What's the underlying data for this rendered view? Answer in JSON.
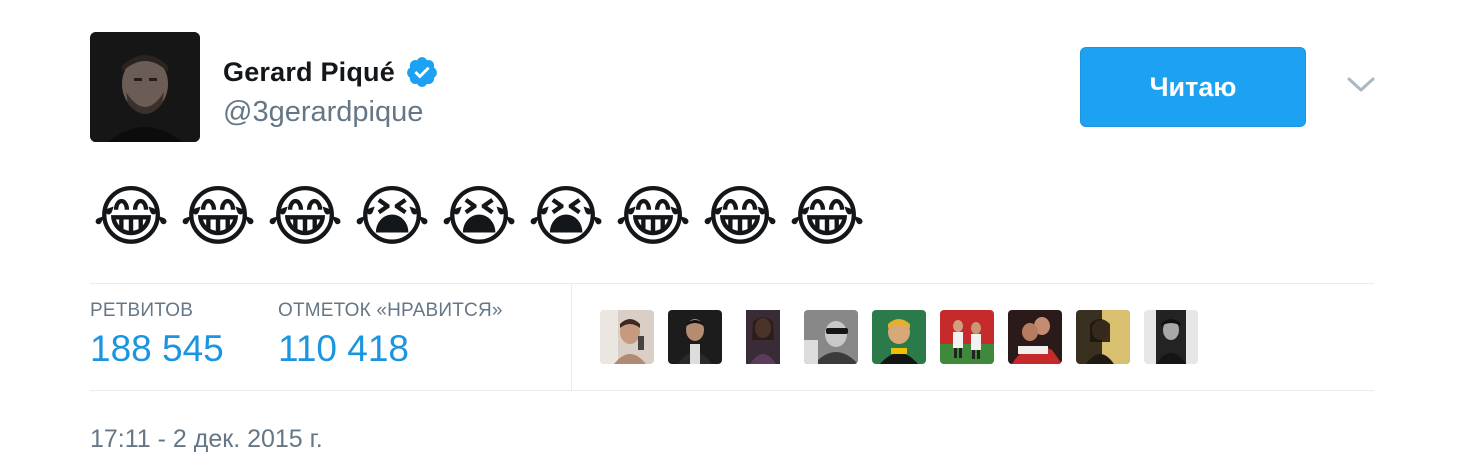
{
  "user": {
    "display_name": "Gerard Piqué",
    "handle": "@3gerardpique",
    "verified": true,
    "verified_icon": "verified-badge-icon"
  },
  "header": {
    "follow_button_label": "Читаю",
    "menu_icon": "chevron-down-icon"
  },
  "tweet": {
    "emojis": [
      "😂",
      "😂",
      "😂",
      "😭",
      "😭",
      "😭",
      "😂",
      "😂",
      "😂"
    ]
  },
  "stats": {
    "retweets_label": "РЕТВИТОВ",
    "retweets_value": "188 545",
    "likes_label": "ОТМЕТОК «НРАВИТСЯ»",
    "likes_value": "110 418"
  },
  "likers_count_shown": 9,
  "timestamp": "17:11 - 2 дек. 2015 г.",
  "colors": {
    "accent": "#1da1f2",
    "link": "#1b95e0",
    "muted": "#657786",
    "divider": "#e6ecf0"
  }
}
